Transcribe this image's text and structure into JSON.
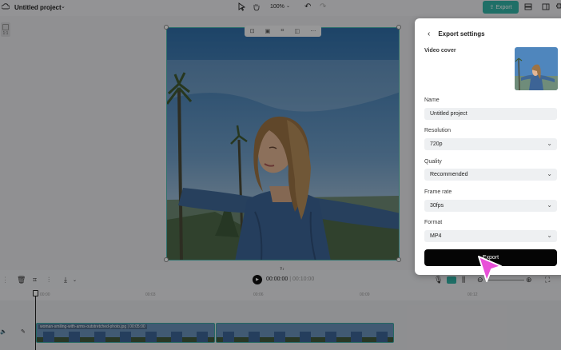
{
  "topbar": {
    "project_title": "Untitled project",
    "zoom": "100%",
    "export_label": "Export"
  },
  "canvas": {
    "aspect_label": "1:1"
  },
  "timeline": {
    "current_time": "00:00:00",
    "total_time": "00:10:00",
    "ticks": [
      "00:00",
      "00:03",
      "00:06",
      "00:09",
      "00:12"
    ],
    "clip_label": "woman-smiling-with-arms-outstretched-photo.jpg | 00:05:00"
  },
  "export_panel": {
    "title": "Export settings",
    "video_cover_label": "Video cover",
    "name_label": "Name",
    "name_value": "Untitled project",
    "resolution_label": "Resolution",
    "resolution_value": "720p",
    "quality_label": "Quality",
    "quality_value": "Recommended",
    "frame_rate_label": "Frame rate",
    "frame_rate_value": "30fps",
    "format_label": "Format",
    "format_value": "MP4",
    "export_button": "Export"
  },
  "colors": {
    "accent": "#33b3a6",
    "cursor": "#e84fd8",
    "export_button": "#050505"
  }
}
